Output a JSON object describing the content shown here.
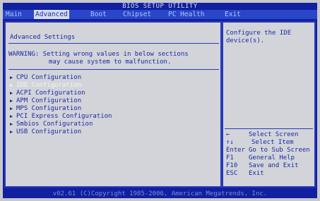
{
  "title": "BIOS SETUP UTILITY",
  "menu": [
    "Main",
    "Advanced",
    "Boot",
    "Chipset",
    "PC Health",
    "Exit"
  ],
  "section_title": "Advanced Settings",
  "warning": {
    "line1": "WARNING: Setting wrong values in below sections",
    "line2": "may cause system to malfunction."
  },
  "options": [
    "CPU Configuration",
    "IDE Configuration",
    "ACPI Configuration",
    "APM Configuration",
    "MPS Configuration",
    "PCI Express Configuration",
    "Smbios Configuration",
    "USB Configuration"
  ],
  "selected_option": "IDE Configuration",
  "help": "Configure the IDE device(s).",
  "keys": [
    {
      "key": "←",
      "desc": "Select Screen"
    },
    {
      "key": "↑↓",
      "desc": "Select Item"
    },
    {
      "key": "Enter",
      "desc": "Go to Sub Screen"
    },
    {
      "key": "F1",
      "desc": "General Help"
    },
    {
      "key": "F10",
      "desc": "Save and Exit"
    },
    {
      "key": "ESC",
      "desc": "Exit"
    }
  ],
  "footer": "v02.61 (C)Copyright 1985-2006, American Megatrends, Inc."
}
